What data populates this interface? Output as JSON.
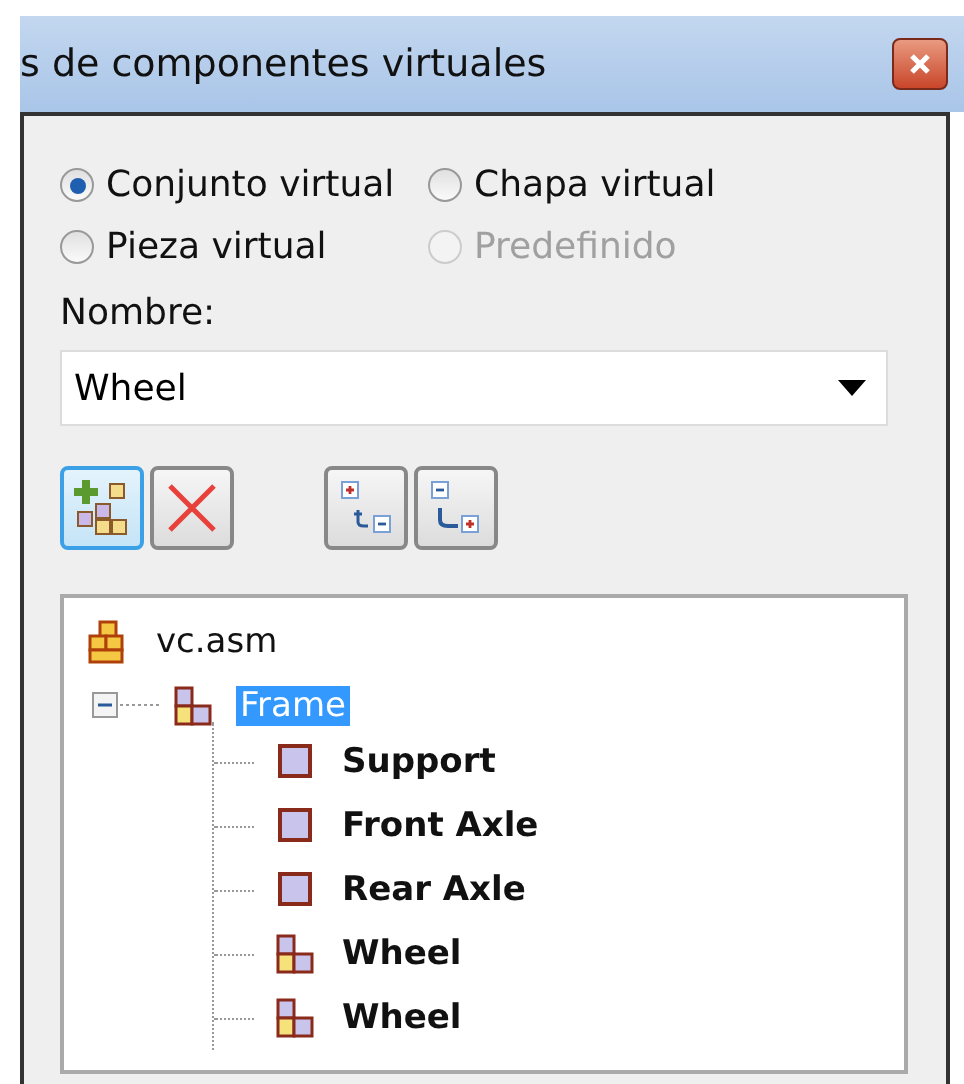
{
  "window": {
    "title": "s de componentes virtuales"
  },
  "component_type": [
    {
      "label": "Conjunto virtual",
      "selected": true,
      "disabled": false
    },
    {
      "label": "Chapa virtual",
      "selected": false,
      "disabled": false
    },
    {
      "label": "Pieza virtual",
      "selected": false,
      "disabled": false
    },
    {
      "label": "Predefinido",
      "selected": false,
      "disabled": true
    }
  ],
  "name_field": {
    "label": "Nombre:",
    "value": "Wheel"
  },
  "toolbar": [
    {
      "kind": "add",
      "highlighted": true
    },
    {
      "kind": "delete",
      "highlighted": false
    },
    {
      "kind": "promote",
      "highlighted": false
    },
    {
      "kind": "demote",
      "highlighted": false
    }
  ],
  "tree": [
    {
      "label": "vc.asm",
      "kind": "root",
      "bold": false,
      "selected": false,
      "children": [
        {
          "label": "Frame",
          "kind": "subassembly",
          "bold": false,
          "selected": true,
          "expanded": true,
          "children": [
            {
              "label": "Support",
              "kind": "part",
              "bold": true,
              "selected": false
            },
            {
              "label": "Front Axle",
              "kind": "part",
              "bold": true,
              "selected": false
            },
            {
              "label": "Rear Axle",
              "kind": "part",
              "bold": true,
              "selected": false
            },
            {
              "label": "Wheel",
              "kind": "subassembly",
              "bold": true,
              "selected": false
            },
            {
              "label": "Wheel",
              "kind": "subassembly",
              "bold": true,
              "selected": false
            }
          ]
        }
      ]
    }
  ]
}
